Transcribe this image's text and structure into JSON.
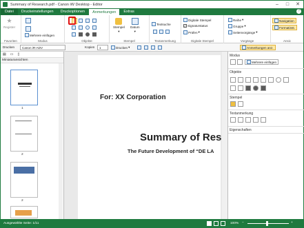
{
  "window": {
    "title": "Summary of Research.pdf - Canon iW Desktop - Editor"
  },
  "tabs": [
    "Datei",
    "Druckeinstellungen",
    "Druckoptionen",
    "Anmerkungen",
    "Extras"
  ],
  "ribbon": {
    "favoriten": {
      "register": "Register",
      "label": "Favoriten"
    },
    "modus": {
      "mehrere": "Mehrere einfügen",
      "label": "Modus"
    },
    "objekte": {
      "label": "Objekte"
    },
    "stempel": {
      "stempel": "Stempel",
      "datum": "Datum",
      "label": "Stempel"
    },
    "textanmerkung": {
      "textsuche": "Textsuche",
      "label": "Textanmerkung"
    },
    "digitale": {
      "digitale_stempel": "Digitale Stempel",
      "signaturstatus": "Signaturstatus",
      "pruefen": "Prüfen",
      "label": "Digitale Stempel"
    },
    "vorgaenge": {
      "reihe": "Reihe",
      "gruppe": "Gruppe",
      "seitenvorgaenge": "Seitenvorgänge",
      "label": "Vorgänge"
    },
    "ansicht": {
      "navigation": "Navigation",
      "formatinst": "Formatinst.",
      "label": "Ansic"
    }
  },
  "toolbar2": {
    "drucken_label": "Drucken",
    "printer": "Canon iR-ADV",
    "kopien_label": "Kopien",
    "kopien_value": "1",
    "drucken_btn": "Drucken",
    "anm_btn": "Anmerkungen anz."
  },
  "left": {
    "header": "Miniaturansichten",
    "pages": [
      "1",
      "2",
      "2",
      "2"
    ]
  },
  "doc": {
    "for_line": "For: XX Corporation",
    "title": "Summary of Res",
    "subtitle": "The Future Development of “DE LA"
  },
  "right": {
    "modus": "Modus",
    "mehrere": "Mehrere einfügen",
    "objekte": "Objekte",
    "stempel": "Stempel",
    "textanmerkung": "Textanmerkung",
    "eigenschaften": "Eigenschaften"
  },
  "status": {
    "left": "Ausgewählte Seite: 1/11",
    "zoom": "100%"
  }
}
